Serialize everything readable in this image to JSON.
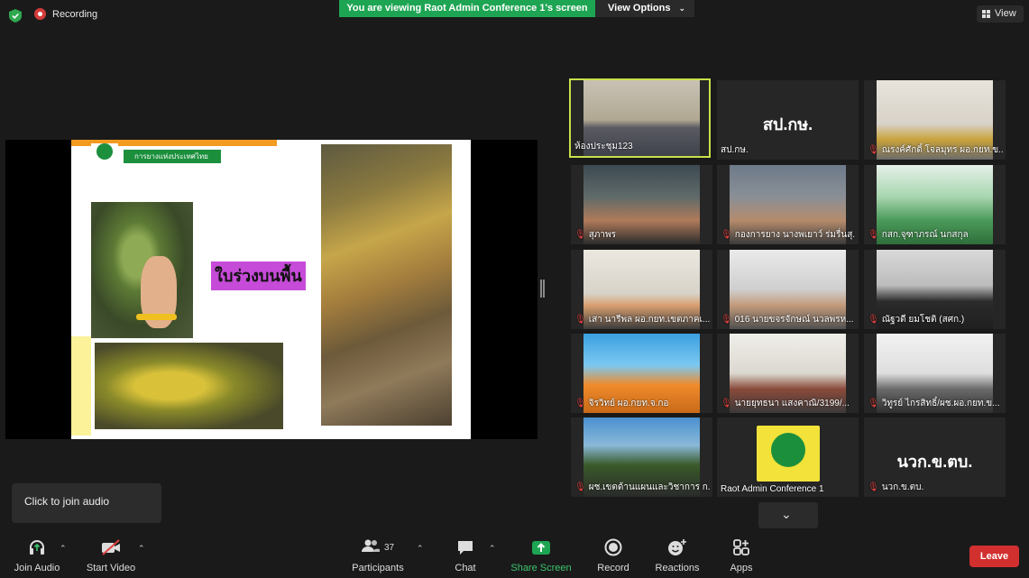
{
  "topbar": {
    "recording_label": "Recording",
    "viewing_banner": "You are viewing Raot Admin Conference 1's screen",
    "view_options_label": "View Options",
    "view_label": "View"
  },
  "shared_screen": {
    "org_name": "การยางแห่งประเทศไทย",
    "slide_title": "ใบร่วงบนพื้น"
  },
  "participants": [
    {
      "name": "ห้องประชุม123",
      "muted": false,
      "active": true
    },
    {
      "name": "สป.กษ.",
      "muted": false,
      "big_text": "สป.กษ."
    },
    {
      "name": "ณรงค์ศักดิ์ โจลมุทร ผอ.กยท.ข...",
      "muted": true
    },
    {
      "name": "สุภาพร",
      "muted": true
    },
    {
      "name": "กองการยาง นางพเยาว์ ร่มรื่นสุ...",
      "muted": true
    },
    {
      "name": "กสก.จุฑาภรณ์ นกสกุล",
      "muted": true
    },
    {
      "name": "เสา นารีพล ผอ.กยท.เขตภาคเ...",
      "muted": true
    },
    {
      "name": "016 นายขจรจักษณ์ นวลพรห...",
      "muted": true
    },
    {
      "name": "ณัฐวดี ยมโชติ (สศก.)",
      "muted": true
    },
    {
      "name": "จิรวิทย์ ผอ.กยท.จ.กอ",
      "muted": true
    },
    {
      "name": "นายยุทธนา แสงคาณิ/3199/...",
      "muted": true
    },
    {
      "name": "วิทูรย์ ไกรสิทธิ์/ผช.ผอ.กยท.ข...",
      "muted": true
    },
    {
      "name": "ผช.เขตด้านแผนและวิชาการ ก...",
      "muted": true
    },
    {
      "name": "Raot Admin Conference 1",
      "muted": false,
      "logo": true
    },
    {
      "name": "นวก.ข.ตบ.",
      "muted": true,
      "big_text": "นวก.ข.ตบ."
    }
  ],
  "tooltip": "Click to join audio",
  "toolbar": {
    "join_audio": "Join Audio",
    "start_video": "Start Video",
    "participants": "Participants",
    "participants_count": "37",
    "chat": "Chat",
    "share_screen": "Share Screen",
    "record": "Record",
    "reactions": "Reactions",
    "apps": "Apps",
    "leave": "Leave"
  },
  "colors": {
    "green_banner": "#1ea553",
    "leave_red": "#d22f2f",
    "share_green": "#3ec46d",
    "active_border": "#c8e04a"
  }
}
